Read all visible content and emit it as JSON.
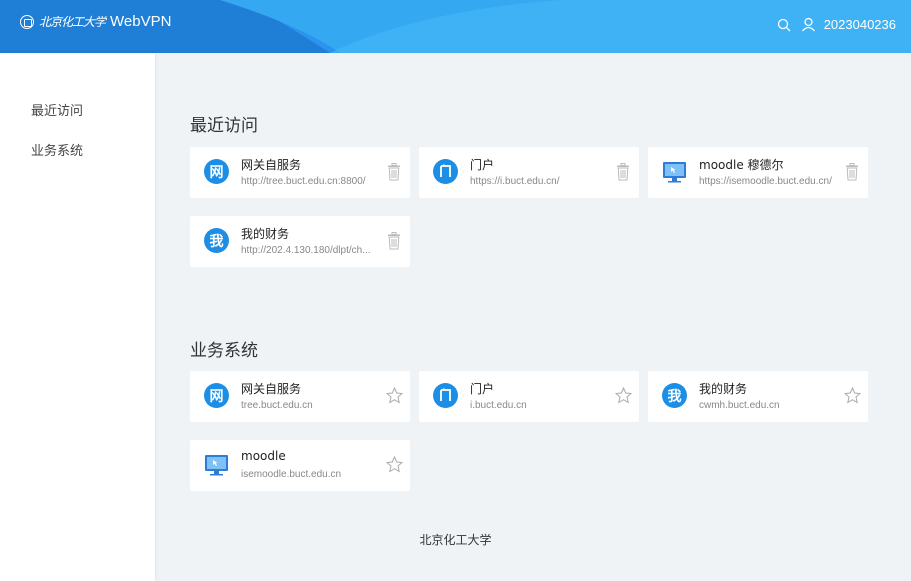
{
  "header": {
    "school_name": "北京化工大学",
    "app_name": "WebVPN",
    "username": "2023040236",
    "colors": {
      "primary": "#2a94ee",
      "highlight": "#37aef5"
    }
  },
  "sidebar": {
    "items": [
      {
        "label": "最近访问"
      },
      {
        "label": "业务系统"
      }
    ]
  },
  "recent": {
    "title": "最近访问",
    "cards": [
      {
        "icon": "网",
        "icon_type": "circle",
        "title": "网关自服务",
        "url": "http://tree.buct.edu.cn:8800/",
        "action": "trash-icon"
      },
      {
        "icon": "门",
        "icon_type": "door",
        "title": "门户",
        "url": "https://i.buct.edu.cn/",
        "action": "trash-icon"
      },
      {
        "icon": "",
        "icon_type": "monitor",
        "title": "moodle 穆德尔",
        "url": "https://isemoodle.buct.edu.cn/",
        "action": "trash-icon"
      },
      {
        "icon": "我",
        "icon_type": "circle",
        "title": "我的财务",
        "url": "http://202.4.130.180/dlpt/ch...",
        "action": "trash-icon"
      }
    ]
  },
  "systems": {
    "title": "业务系统",
    "cards": [
      {
        "icon": "网",
        "icon_type": "circle",
        "title": "网关自服务",
        "url": "tree.buct.edu.cn",
        "action": "star-icon"
      },
      {
        "icon": "门",
        "icon_type": "door",
        "title": "门户",
        "url": "i.buct.edu.cn",
        "action": "star-icon"
      },
      {
        "icon": "我",
        "icon_type": "circle",
        "title": "我的财务",
        "url": "cwmh.buct.edu.cn",
        "action": "star-icon"
      },
      {
        "icon": "",
        "icon_type": "monitor",
        "title": "moodle",
        "url": "isemoodle.buct.edu.cn",
        "action": "star-icon"
      }
    ]
  },
  "footer": {
    "text": "北京化工大学"
  }
}
